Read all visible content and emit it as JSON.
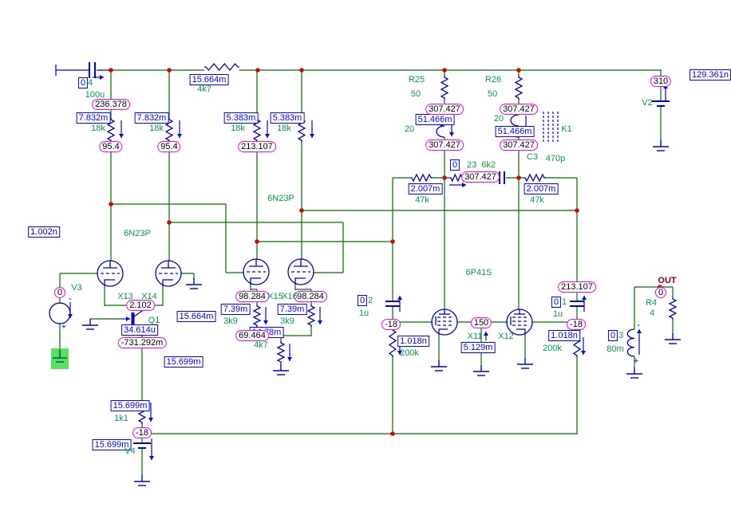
{
  "app": {
    "view": "circuit-schematic-canvas"
  },
  "schematic": {
    "node_voltages": {
      "v236": "236.378",
      "v95": "95.4",
      "v213": "213.107",
      "v307": "307.427",
      "v2102": "2.102",
      "vn731": "-731.292m",
      "v98": "98.284",
      "v69": "69.464",
      "vm18": "-18",
      "v150": "150",
      "v310": "310",
      "v0": "0"
    },
    "currents": {
      "i7832": "7.832m",
      "i15664": "15.664m",
      "i5383": "5.383m",
      "i51466": "51.466m",
      "i2007": "2.007m",
      "i1002": "1.002n",
      "i34614": "34.614u",
      "i15699": "15.699m",
      "i739": "7.39m",
      "i1478": "14.78m",
      "i1018": "1.018n",
      "i5129": "5.129m",
      "i129": "129.361n",
      "i0": "0"
    },
    "components": {
      "c100u": "100u",
      "c4n": "4",
      "r4k7": "4k7",
      "r18k": "18k",
      "r25": "R25",
      "r26": "R26",
      "r50": "50",
      "l20": "20",
      "k1": "K1",
      "c3": "C3",
      "c470p": "470p",
      "r23": "23  6k2",
      "r47k": "47k",
      "t6n23p": "6N23P",
      "t6p41s": "6P41S",
      "v3": "V3",
      "x13": "X13",
      "x14": "X14",
      "q1": "Q1",
      "x15": "X15",
      "x16": "X16",
      "r3k9": "3k9",
      "x11": "X11",
      "x12": "X12",
      "r200k": "200k",
      "cap1u": "1u",
      "n1": "1",
      "n2": "2",
      "n3": "3",
      "l80m": "80m",
      "r1k1": "1k1",
      "v4": "V4",
      "v2": "V2",
      "r4": "R4",
      "r4v": "4",
      "out": "OUT",
      "plus": "+",
      "minus": "-"
    }
  }
}
